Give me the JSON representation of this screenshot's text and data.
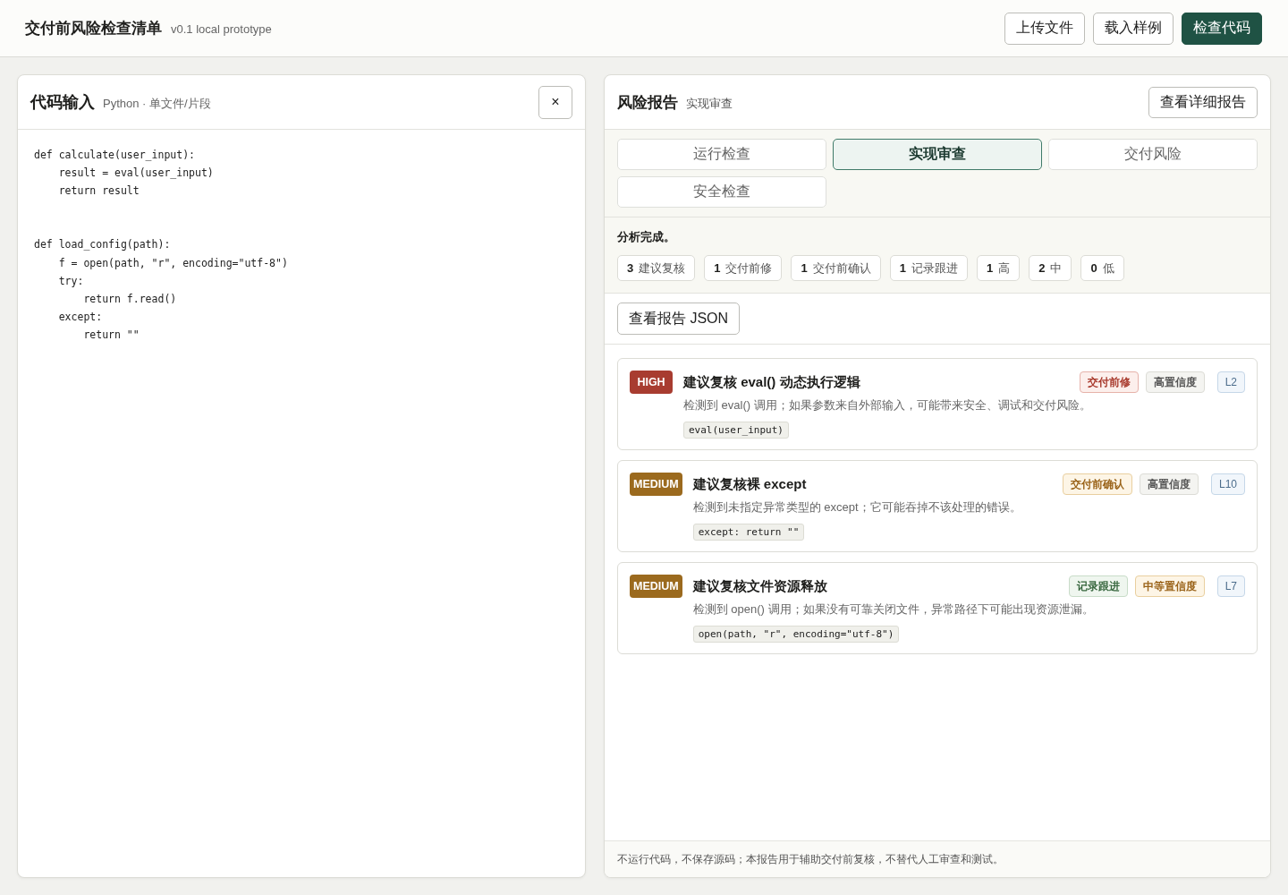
{
  "header": {
    "title": "交付前风险检查清单",
    "version": "v0.1 local prototype",
    "buttons": [
      {
        "label": "上传文件",
        "kind": "secondary"
      },
      {
        "label": "载入样例",
        "kind": "secondary"
      },
      {
        "label": "检查代码",
        "kind": "primary"
      }
    ]
  },
  "code_panel": {
    "title": "代码输入",
    "subtitle": "Python · 单文件/片段",
    "close_button": "×",
    "code": "def calculate(user_input):\n    result = eval(user_input)\n    return result\n\n\ndef load_config(path):\n    f = open(path, \"r\", encoding=\"utf-8\")\n    try:\n        return f.read()\n    except:\n        return \"\""
  },
  "report_panel": {
    "title": "风险报告",
    "subtitle": "实现审查",
    "detail_button": "查看详细报告",
    "tabs": [
      {
        "label": "运行检查",
        "selected": false
      },
      {
        "label": "实现审查",
        "selected": true
      },
      {
        "label": "交付风险",
        "selected": false
      },
      {
        "label": "安全检查",
        "selected": false
      }
    ],
    "status": "分析完成。",
    "summary": [
      {
        "count": "3",
        "label": "建议复核"
      },
      {
        "count": "1",
        "label": "交付前修"
      },
      {
        "count": "1",
        "label": "交付前确认"
      },
      {
        "count": "1",
        "label": "记录跟进"
      },
      {
        "count": "1",
        "label": "高"
      },
      {
        "count": "2",
        "label": "中"
      },
      {
        "count": "0",
        "label": "低"
      }
    ],
    "json_button": "查看报告 JSON",
    "findings": [
      {
        "kind": "high",
        "badge": "HIGH",
        "title": "建议复核 eval() 动态执行逻辑",
        "description": "检测到 eval() 调用；如果参数来自外部输入，可能带来安全、调试和交付风险。",
        "snippet": "eval(user_input)",
        "tags": [
          {
            "label": "交付前修",
            "kind": "danger"
          },
          {
            "label": "高置信度",
            "kind": "neutral"
          },
          {
            "label": "L2",
            "kind": "info"
          }
        ]
      },
      {
        "kind": "medium",
        "badge": "MEDIUM",
        "title": "建议复核裸 except",
        "description": "检测到未指定异常类型的 except；它可能吞掉不该处理的错误。",
        "snippet": "except: return \"\"",
        "tags": [
          {
            "label": "交付前确认",
            "kind": "warning"
          },
          {
            "label": "高置信度",
            "kind": "neutral"
          },
          {
            "label": "L10",
            "kind": "info"
          }
        ]
      },
      {
        "kind": "medium",
        "badge": "MEDIUM",
        "title": "建议复核文件资源释放",
        "description": "检测到 open() 调用；如果没有可靠关闭文件，异常路径下可能出现资源泄漏。",
        "snippet": "open(path, \"r\", encoding=\"utf-8\")",
        "tags": [
          {
            "label": "记录跟进",
            "kind": "success"
          },
          {
            "label": "中等置信度",
            "kind": "warning"
          },
          {
            "label": "L7",
            "kind": "info"
          }
        ]
      }
    ],
    "footer": "不运行代码，不保存源码；本报告用于辅助交付前复核，不替代人工审查和测试。"
  }
}
